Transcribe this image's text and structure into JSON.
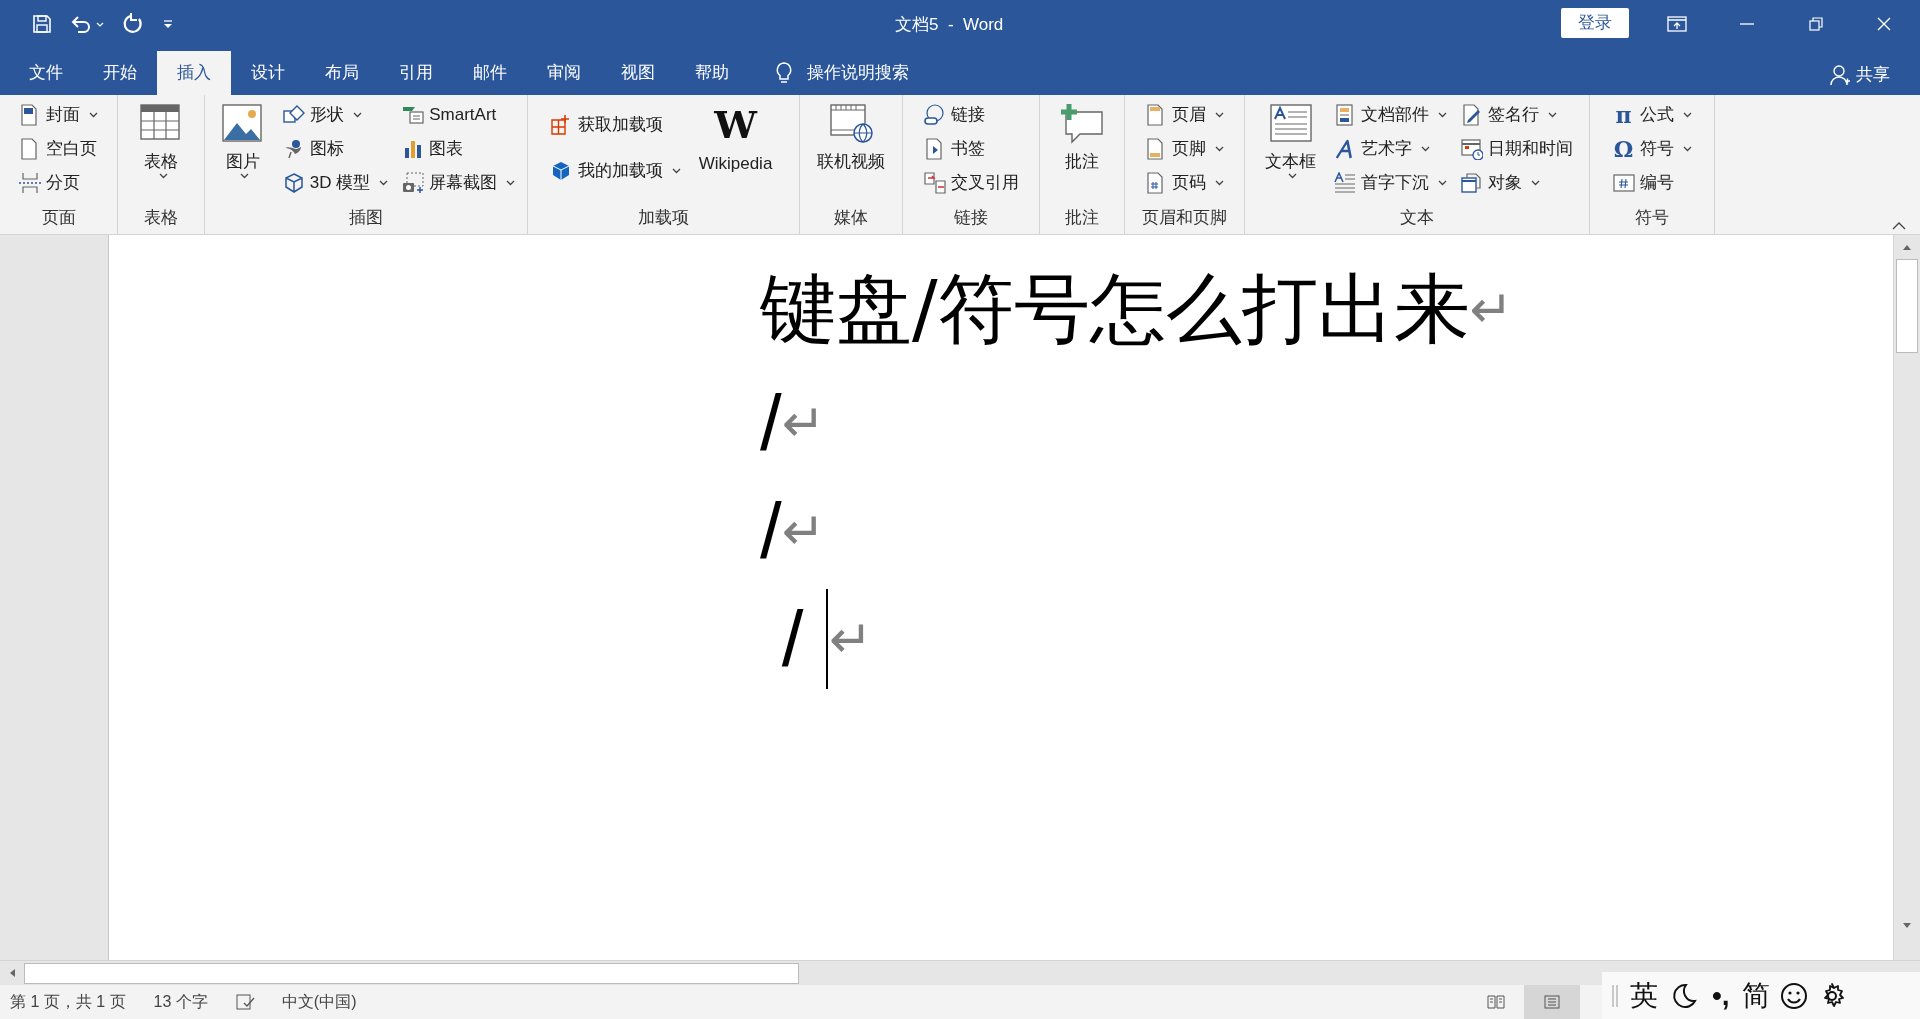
{
  "window": {
    "title": "文档5  -  Word",
    "sign_in": "登录"
  },
  "tabs": [
    {
      "label": "文件",
      "selected": false
    },
    {
      "label": "开始",
      "selected": false
    },
    {
      "label": "插入",
      "selected": true
    },
    {
      "label": "设计",
      "selected": false
    },
    {
      "label": "布局",
      "selected": false
    },
    {
      "label": "引用",
      "selected": false
    },
    {
      "label": "邮件",
      "selected": false
    },
    {
      "label": "审阅",
      "selected": false
    },
    {
      "label": "视图",
      "selected": false
    },
    {
      "label": "帮助",
      "selected": false
    }
  ],
  "tell_me": "操作说明搜索",
  "share": "共享",
  "ribbon": [
    {
      "label": "页面",
      "columns": [
        {
          "kind": "stack",
          "items": [
            {
              "label": "封面",
              "dropdown": true
            },
            {
              "label": "空白页",
              "dropdown": false
            },
            {
              "label": "分页",
              "dropdown": false
            }
          ]
        }
      ]
    },
    {
      "label": "表格",
      "columns": [
        {
          "kind": "large",
          "label": "表格",
          "dropdown": true
        }
      ]
    },
    {
      "label": "插图",
      "columns": [
        {
          "kind": "large",
          "label": "图片",
          "dropdown": true
        },
        {
          "kind": "stack",
          "items": [
            {
              "label": "形状",
              "dropdown": true
            },
            {
              "label": "图标",
              "dropdown": false
            },
            {
              "label": "3D 模型",
              "dropdown": true
            }
          ]
        },
        {
          "kind": "stack",
          "items": [
            {
              "label": "SmartArt",
              "dropdown": false
            },
            {
              "label": "图表",
              "dropdown": false
            },
            {
              "label": "屏幕截图",
              "dropdown": true
            }
          ]
        }
      ]
    },
    {
      "label": "加载项",
      "columns": [
        {
          "kind": "pair",
          "items": [
            {
              "label": "获取加载项",
              "dropdown": false
            },
            {
              "label": "我的加载项",
              "dropdown": true
            }
          ]
        },
        {
          "kind": "glyph",
          "glyph": "W",
          "label": "Wikipedia",
          "dropdown": false
        }
      ]
    },
    {
      "label": "媒体",
      "columns": [
        {
          "kind": "large",
          "label": "联机视频",
          "dropdown": false
        }
      ]
    },
    {
      "label": "链接",
      "columns": [
        {
          "kind": "stack",
          "items": [
            {
              "label": "链接",
              "dropdown": false
            },
            {
              "label": "书签",
              "dropdown": false
            },
            {
              "label": "交叉引用",
              "dropdown": false
            }
          ]
        }
      ]
    },
    {
      "label": "批注",
      "columns": [
        {
          "kind": "large",
          "label": "批注",
          "dropdown": false
        }
      ]
    },
    {
      "label": "页眉和页脚",
      "columns": [
        {
          "kind": "stack",
          "items": [
            {
              "label": "页眉",
              "dropdown": true
            },
            {
              "label": "页脚",
              "dropdown": true
            },
            {
              "label": "页码",
              "dropdown": true
            }
          ]
        }
      ]
    },
    {
      "label": "文本",
      "columns": [
        {
          "kind": "large",
          "label": "文本框",
          "dropdown": true
        },
        {
          "kind": "stack",
          "items": [
            {
              "label": "文档部件",
              "dropdown": true
            },
            {
              "label": "艺术字",
              "dropdown": true
            },
            {
              "label": "首字下沉",
              "dropdown": true
            }
          ]
        },
        {
          "kind": "stack",
          "items": [
            {
              "label": "签名行",
              "dropdown": true
            },
            {
              "label": "日期和时间",
              "dropdown": false
            },
            {
              "label": "对象",
              "dropdown": true
            }
          ]
        }
      ]
    },
    {
      "label": "符号",
      "columns": [
        {
          "kind": "stack",
          "items": [
            {
              "label": "公式",
              "dropdown": true,
              "glyph": "π"
            },
            {
              "label": "符号",
              "dropdown": true,
              "glyph": "Ω"
            },
            {
              "label": "编号",
              "dropdown": false
            }
          ]
        }
      ]
    }
  ],
  "document": {
    "paragraphs": [
      {
        "kind": "heading",
        "text": "键盘/符号怎么打出来",
        "mark": "↵",
        "cursor": false
      },
      {
        "kind": "body",
        "text": "/",
        "mark": "↵",
        "cursor": false
      },
      {
        "kind": "body",
        "text": "/",
        "mark": "↵",
        "cursor": false
      },
      {
        "kind": "body",
        "text": " / ",
        "mark": "↵",
        "cursor": true
      }
    ]
  },
  "status_bar": {
    "page": "第 1 页，共 1 页",
    "words": "13 个字",
    "language": "中文(中国)",
    "views": [
      {
        "selected": false
      },
      {
        "selected": true
      }
    ]
  },
  "ime_bar": {
    "mode": "英",
    "punctuation": "•,",
    "script": "简"
  }
}
